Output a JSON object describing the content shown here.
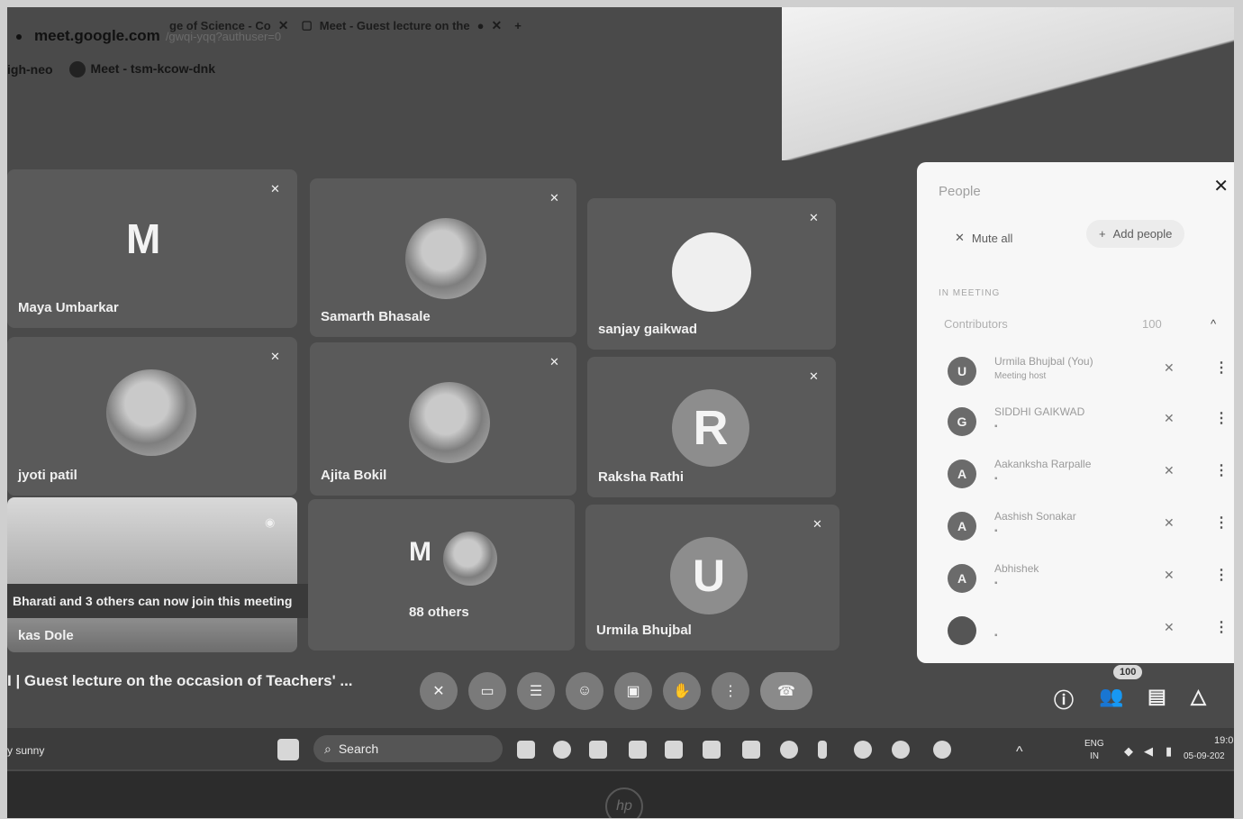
{
  "browser": {
    "tabs": [
      {
        "label": "ge of Science - Co",
        "close": "✕"
      },
      {
        "label": "Meet - Guest lecture on the",
        "close": "✕"
      }
    ],
    "new_tab": "+",
    "url_host": "meet.google.com",
    "url_rest": "/gwqi-yqq?authuser=0",
    "bookmarks": [
      "igh-neo",
      "Meet - tsm-kcow-dnk"
    ]
  },
  "tiles": [
    {
      "name": "Maya Umbarkar",
      "letter": "M"
    },
    {
      "name": "Samarth Bhasale"
    },
    {
      "name": "sanjay gaikwad"
    },
    {
      "name": "jyoti patil"
    },
    {
      "name": "Ajita Bokil"
    },
    {
      "name": "Raksha Rathi",
      "letter": "R"
    },
    {
      "name": "kas Dole"
    },
    {
      "name": "88 others",
      "letter": "M"
    },
    {
      "name": "Urmila Bhujbal",
      "letter": "U"
    }
  ],
  "toast": "Bharati and 3 others can now join this meeting",
  "people_panel": {
    "title": "People",
    "close": "✕",
    "mute_all": "Mute all",
    "add_people": "Add people",
    "section": "IN MEETING",
    "contributors": "Contributors",
    "count": "100",
    "chevron": "^",
    "participants": [
      {
        "letter": "U",
        "name": "Urmila Bhujbal (You)",
        "sub": "Meeting host"
      },
      {
        "letter": "G",
        "name": "SIDDHI GAIKWAD",
        "sub": ""
      },
      {
        "letter": "A",
        "name": "Aakanksha Rarpalle",
        "sub": ""
      },
      {
        "letter": "A",
        "name": "Aashish Sonakar",
        "sub": ""
      },
      {
        "letter": "A",
        "name": "Abhishek",
        "sub": ""
      },
      {
        "letter": "",
        "name": "",
        "sub": ""
      }
    ]
  },
  "bottom_bar": {
    "meeting_title": "I  |  Guest lecture on the occasion of Teachers' ...",
    "people_badge": "100"
  },
  "taskbar": {
    "weather": "y sunny",
    "search": "Search",
    "lang": "ENG",
    "region": "IN",
    "time": "19:0",
    "date": "05-09-202"
  },
  "brand": "hp"
}
